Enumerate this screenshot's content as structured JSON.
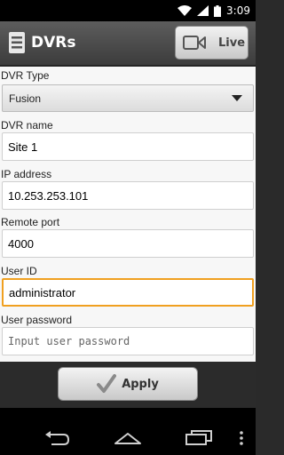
{
  "status_bar": {
    "time": "3:09",
    "icons": [
      "wifi-icon",
      "signal-icon",
      "battery-icon"
    ]
  },
  "action_bar": {
    "title": "DVRs",
    "live_label": "Live"
  },
  "form": {
    "dvr_type": {
      "label": "DVR Type",
      "value": "Fusion"
    },
    "dvr_name": {
      "label": "DVR name",
      "value": "Site 1"
    },
    "ip_address": {
      "label": "IP address",
      "value": "10.253.253.101"
    },
    "remote_port": {
      "label": "Remote port",
      "value": "4000"
    },
    "user_id": {
      "label": "User ID",
      "value": "administrator"
    },
    "user_password": {
      "label": "User password",
      "value": "",
      "placeholder": "Input user password"
    }
  },
  "apply": {
    "label": "Apply"
  },
  "colors": {
    "focus": "#f0a020",
    "action_bar": "#4a4a4a",
    "form_bg": "#f7f7f7"
  }
}
